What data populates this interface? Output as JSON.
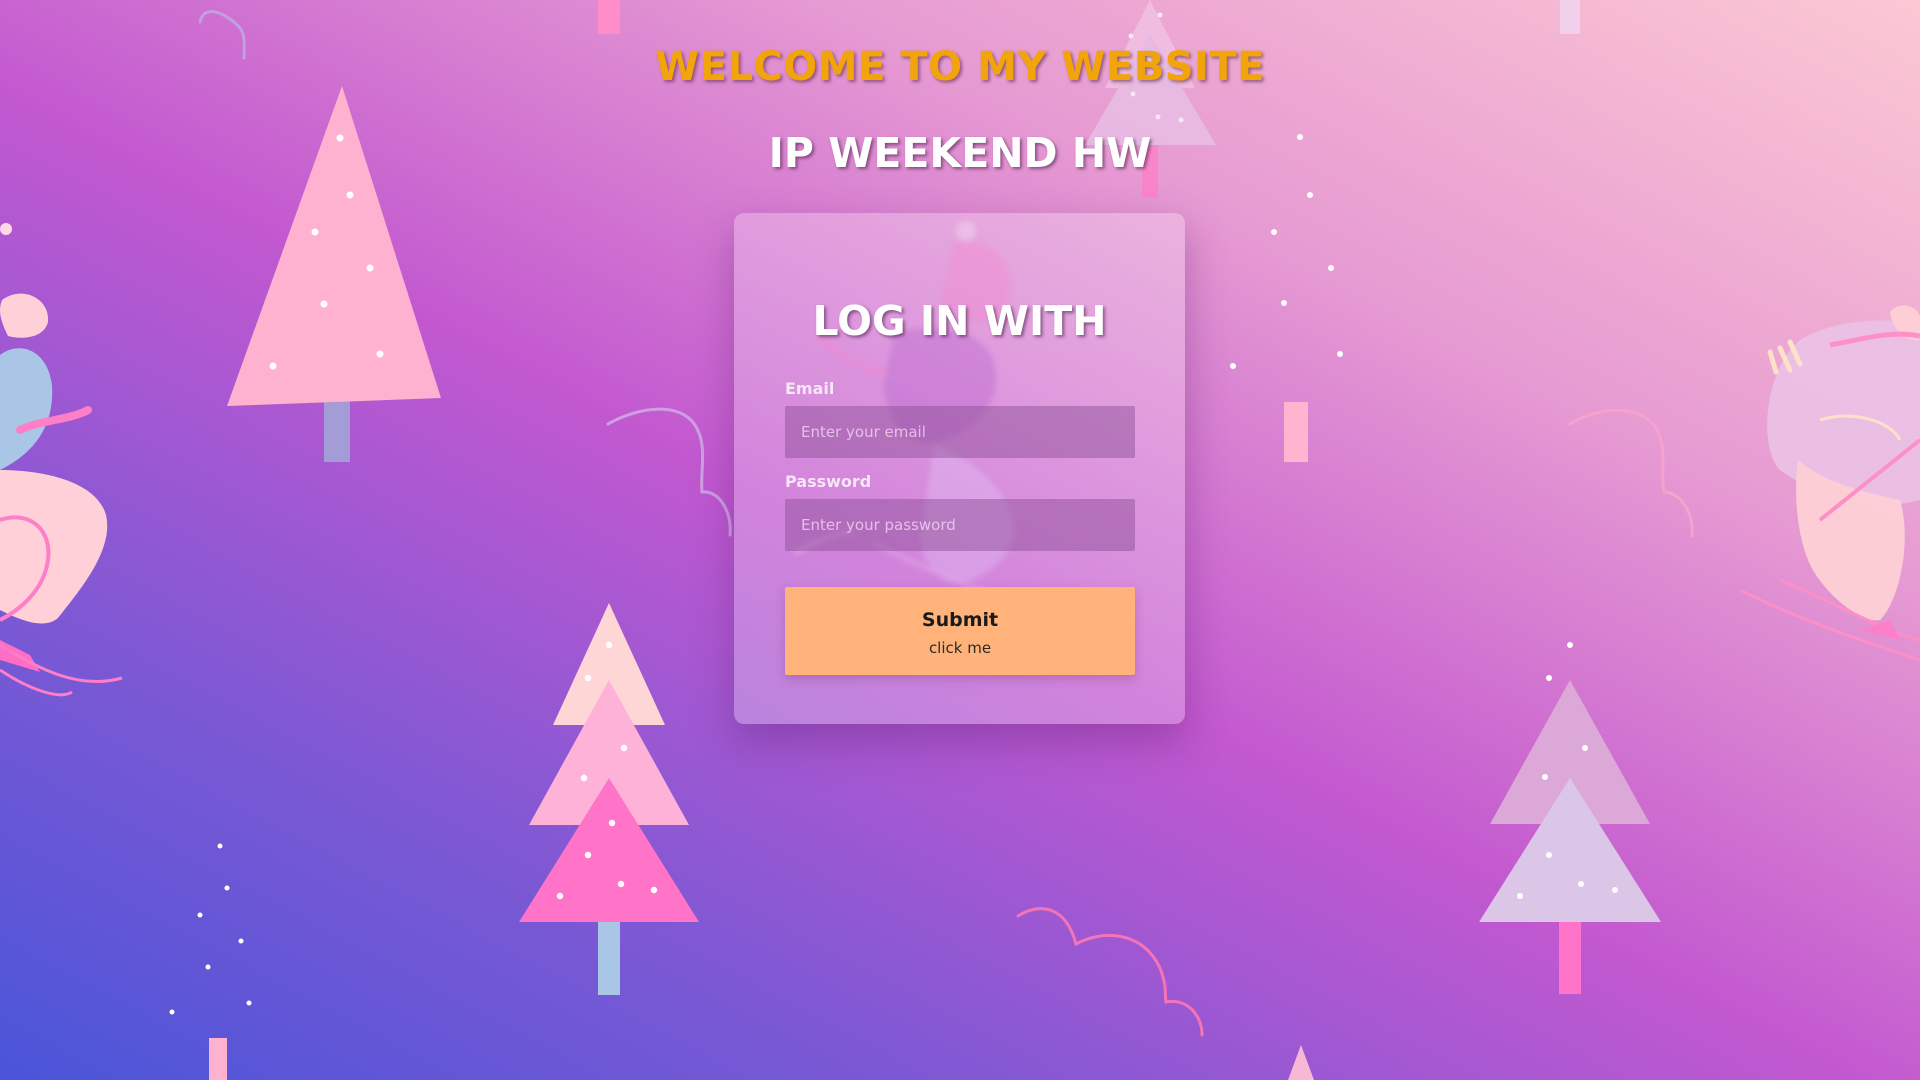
{
  "header": {
    "welcome": "WELCOME TO MY WEBSITE",
    "subtitle": "IP WEEKEND HW"
  },
  "login": {
    "title": "LOG IN WITH",
    "email_label": "Email",
    "email_placeholder": "Enter your email",
    "password_label": "Password",
    "password_placeholder": "Enter your password",
    "submit_label": "Submit",
    "submit_sublabel": "click me"
  },
  "colors": {
    "welcome_text": "#f2a40b",
    "submit_button": "#ffb27a",
    "gradient_start": "#4a55d9",
    "gradient_mid": "#c258d0",
    "gradient_end": "#fcc8d3"
  },
  "decorations": [
    "pine-tree-icon",
    "skier-icon",
    "cloud-squiggle-icon",
    "snowflake-dot-icon"
  ]
}
